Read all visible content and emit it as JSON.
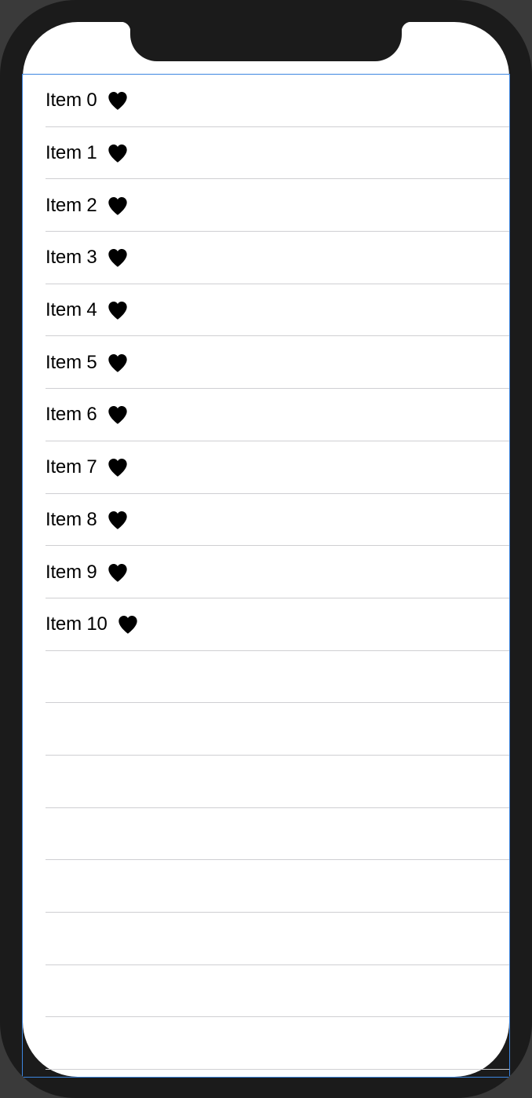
{
  "list": {
    "items": [
      {
        "label": "Item 0",
        "icon": "heart-icon"
      },
      {
        "label": "Item 1",
        "icon": "heart-icon"
      },
      {
        "label": "Item 2",
        "icon": "heart-icon"
      },
      {
        "label": "Item 3",
        "icon": "heart-icon"
      },
      {
        "label": "Item 4",
        "icon": "heart-icon"
      },
      {
        "label": "Item 5",
        "icon": "heart-icon"
      },
      {
        "label": "Item 6",
        "icon": "heart-icon"
      },
      {
        "label": "Item 7",
        "icon": "heart-icon"
      },
      {
        "label": "Item 8",
        "icon": "heart-icon"
      },
      {
        "label": "Item 9",
        "icon": "heart-icon"
      },
      {
        "label": "Item 10",
        "icon": "heart-icon"
      }
    ],
    "empty_rows": 8
  },
  "colors": {
    "selection_border": "#3d86e0",
    "separator": "#cfcfd2",
    "device_bezel": "#1b1b1b",
    "background": "#ffffff",
    "text": "#000000"
  }
}
